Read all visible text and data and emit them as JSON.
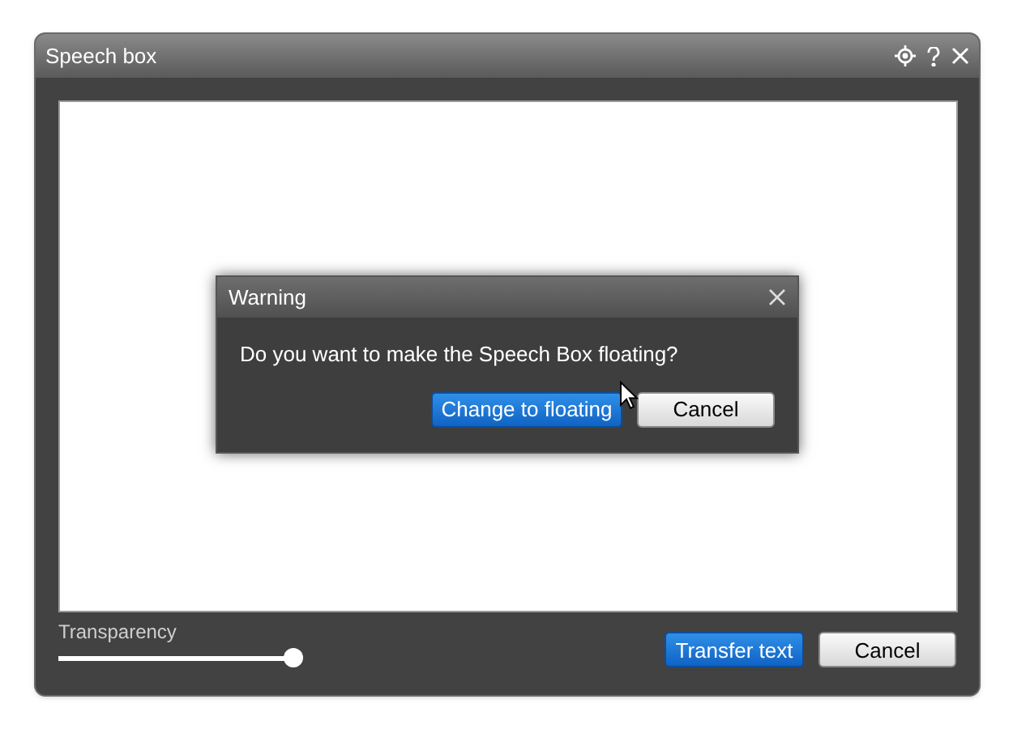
{
  "window": {
    "title": "Speech box"
  },
  "transparency": {
    "label": "Transparency",
    "level": 1
  },
  "buttons": [
    {
      "label": "Transfer text",
      "kind": "primary"
    },
    {
      "label": "Cancel",
      "kind": "secondary"
    }
  ],
  "dialog": {
    "title": "Warning",
    "message": "Do you want to make the Speech Box floating?",
    "buttons": [
      {
        "label": "Change to floating",
        "kind": "primary"
      },
      {
        "label": "Cancel",
        "kind": "secondary"
      }
    ]
  }
}
